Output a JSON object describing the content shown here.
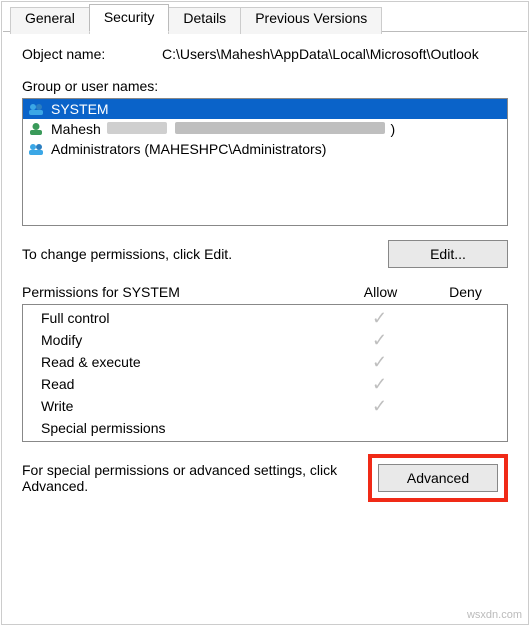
{
  "tabs": {
    "general": "General",
    "security": "Security",
    "details": "Details",
    "previous": "Previous Versions"
  },
  "object_name_label": "Object name:",
  "object_name_value": "C:\\Users\\Mahesh\\AppData\\Local\\Microsoft\\Outlook",
  "group_label": "Group or user names:",
  "principals": {
    "p0": "SYSTEM",
    "p1_prefix": "Mahesh",
    "p1_suffix": ")",
    "p2": "Administrators (MAHESHPC\\Administrators)"
  },
  "change_hint": "To change permissions, click Edit.",
  "edit_button": "Edit...",
  "perm_title": "Permissions for SYSTEM",
  "col_allow": "Allow",
  "col_deny": "Deny",
  "permissions": {
    "full": "Full control",
    "modify": "Modify",
    "rexec": "Read & execute",
    "read": "Read",
    "write": "Write",
    "special": "Special permissions"
  },
  "checkmark": "✓",
  "advanced_hint": "For special permissions or advanced settings, click Advanced.",
  "advanced_button": "Advanced",
  "watermark": "wsxdn.com"
}
